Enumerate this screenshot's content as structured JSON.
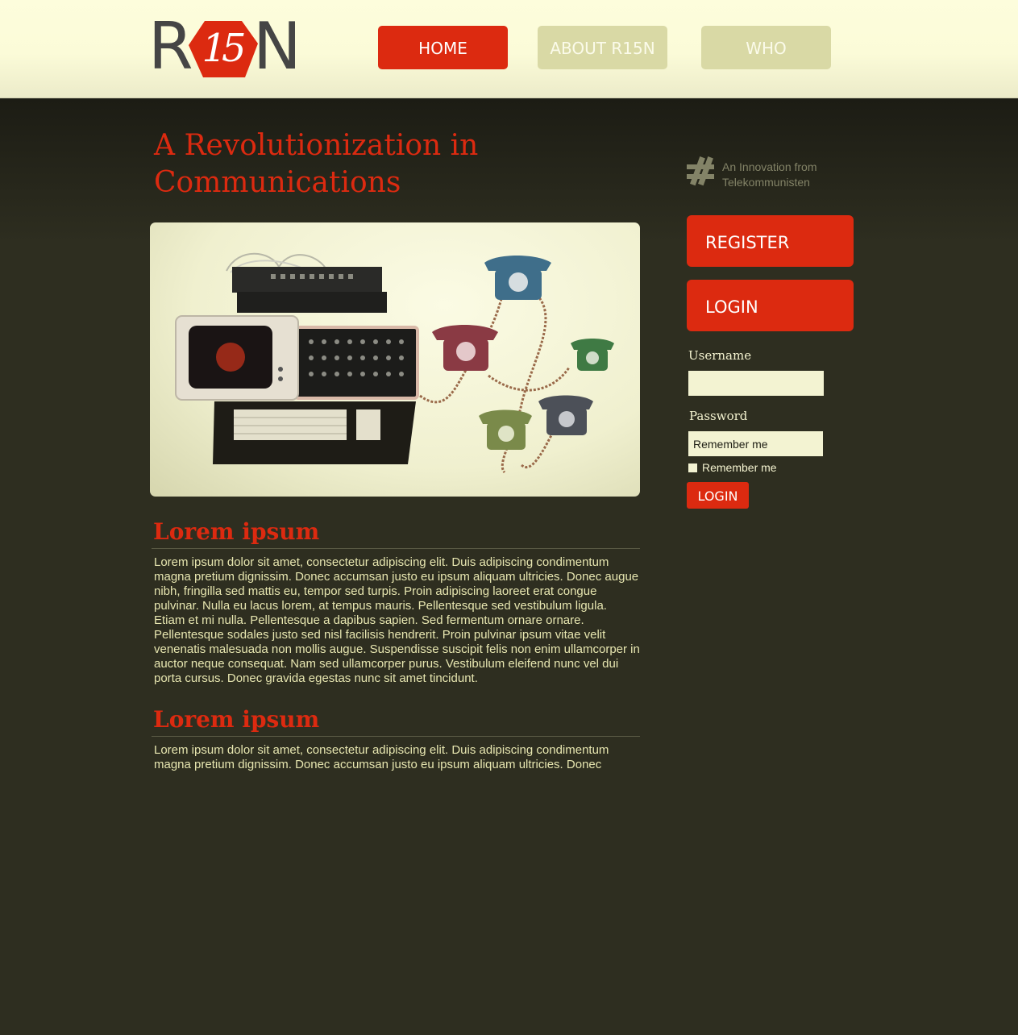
{
  "logo": {
    "left_letter": "R",
    "badge_number": "15",
    "right_letter": "N"
  },
  "nav": {
    "home": "HOME",
    "about": "ABOUT R15N",
    "who": "WHO"
  },
  "main": {
    "headline": "A Revolutionization in Communications",
    "sections": [
      {
        "title": "Lorem ipsum",
        "text": "Lorem ipsum dolor sit amet, consectetur adipiscing elit. Duis adipiscing condimentum magna pretium dignissim. Donec accumsan justo eu ipsum aliquam ultricies. Donec augue nibh, fringilla sed mattis eu, tempor sed turpis. Proin adipiscing laoreet erat congue pulvinar. Nulla eu lacus lorem, at tempus mauris. Pellentesque sed vestibulum ligula. Etiam et mi nulla. Pellentesque a dapibus sapien. Sed fermentum ornare ornare. Pellentesque sodales justo sed nisl facilisis hendrerit. Proin pulvinar ipsum vitae velit venenatis malesuada non mollis augue. Suspendisse suscipit felis non enim ullamcorper in auctor neque consequat. Nam sed ullamcorper purus. Vestibulum eleifend nunc vel dui porta cursus. Donec gravida egestas nunc sit amet tincidunt."
      },
      {
        "title": "Lorem ipsum",
        "text": "Lorem ipsum dolor sit amet, consectetur adipiscing elit. Duis adipiscing condimentum magna pretium dignissim. Donec accumsan justo eu ipsum aliquam ultricies. Donec"
      }
    ]
  },
  "sidebar": {
    "innovation_line1": "An Innovation from",
    "innovation_line2": "Telekommunisten",
    "register_label": "REGISTER",
    "login_label": "LOGIN",
    "username_label": "Username",
    "username_value": "",
    "password_label": "Password",
    "password_value": "Remember me",
    "remember_label": "Remember me",
    "submit_label": "LOGIN"
  },
  "colors": {
    "accent_red": "#dc2a10",
    "nav_inactive": "#d9d9a5",
    "background": "#2e2e20",
    "header_bg": "#fbfbd8",
    "body_text": "#e7e6b0"
  }
}
